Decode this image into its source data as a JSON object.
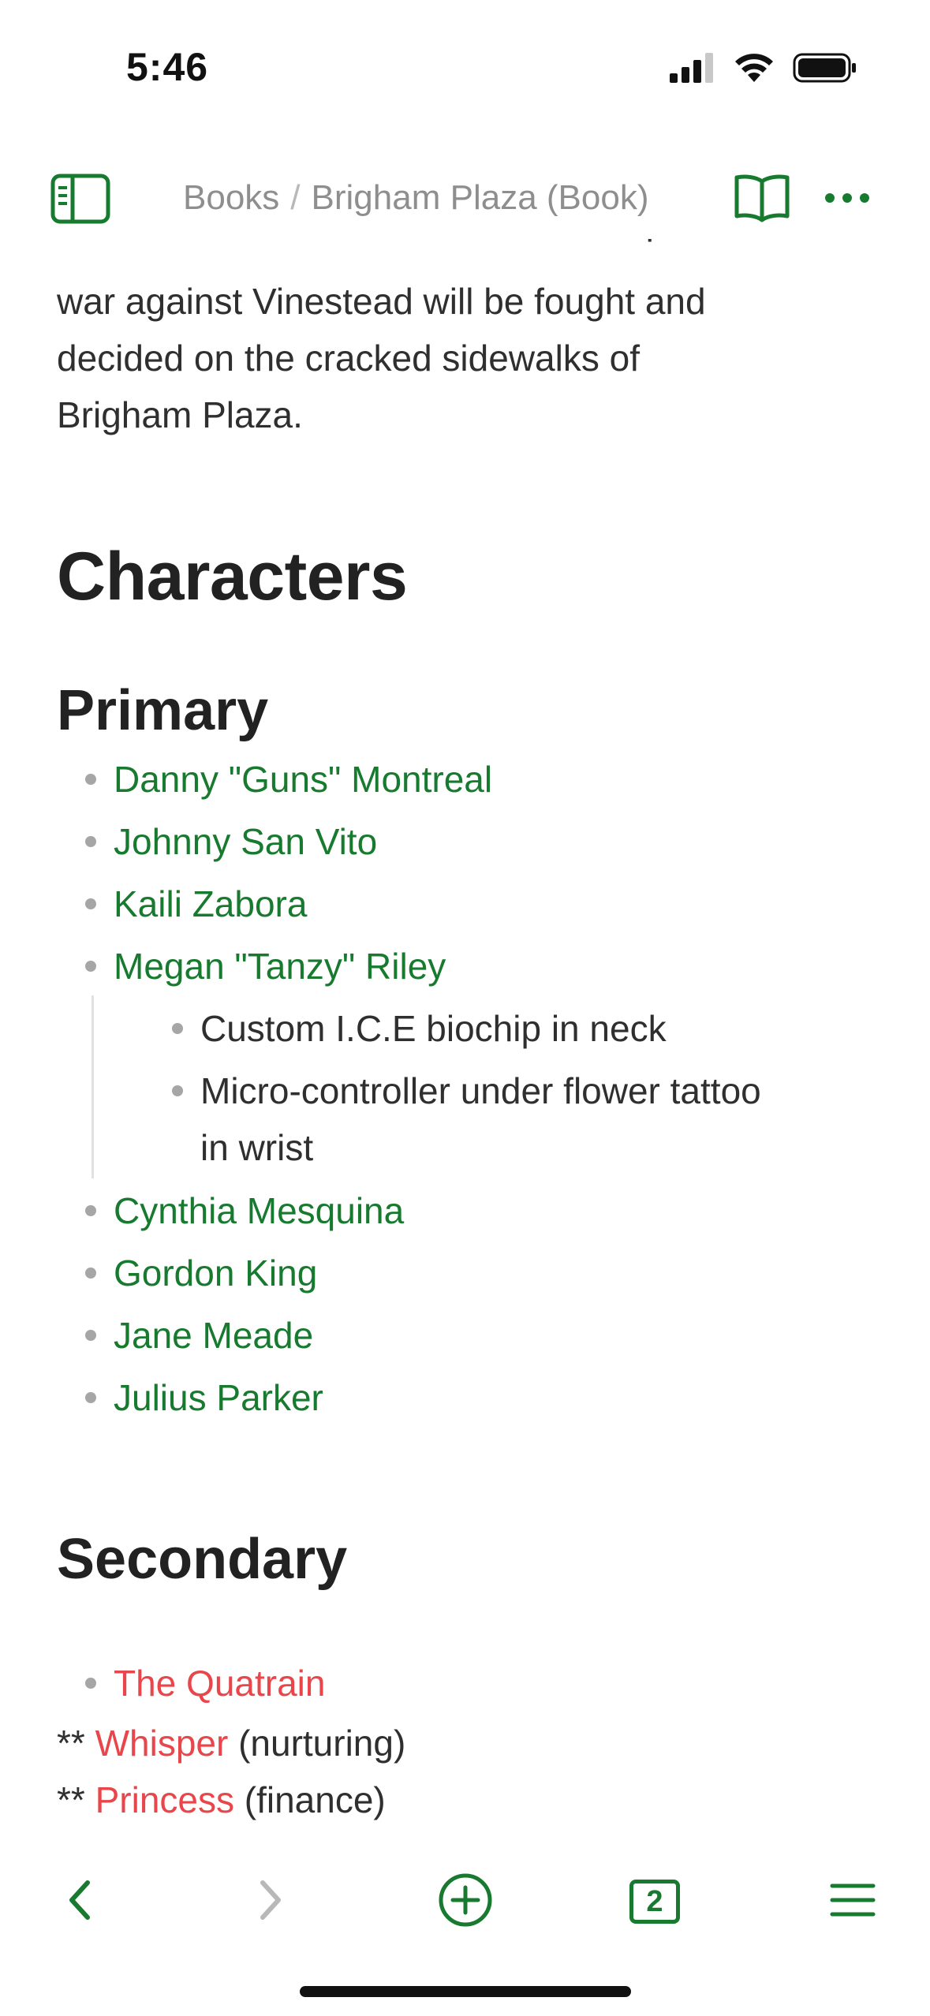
{
  "status_bar": {
    "time": "5:46"
  },
  "header": {
    "breadcrumb_parent": "Books",
    "breadcrumb_separator": "/",
    "breadcrumb_current": "Brigham Plaza (Book)"
  },
  "content": {
    "intro_lines": [
      "war against Vinestead will be fought and",
      "decided on the cracked sidewalks of",
      "Brigham Plaza."
    ],
    "heading_characters": "Characters",
    "heading_primary": "Primary",
    "primary": [
      "Danny \"Guns\" Montreal",
      "Johnny San Vito",
      "Kaili Zabora",
      "Megan \"Tanzy\" Riley"
    ],
    "megan_notes": [
      "Custom I.C.E biochip in neck",
      "Micro-controller under flower tattoo",
      "in wrist"
    ],
    "primary_more": [
      "Cynthia Mesquina",
      "Gordon King",
      "Jane Meade",
      "Julius Parker"
    ],
    "heading_secondary": "Secondary",
    "secondary_item": "The Quatrain",
    "secondary_lines": [
      {
        "prefix": "** ",
        "link": "Whisper",
        "suffix": " (nurturing)"
      },
      {
        "prefix": "** ",
        "link": "Princess",
        "suffix": " (finance)"
      }
    ]
  },
  "toolbar": {
    "tabs_count": "2"
  },
  "colors": {
    "accent": "#177a2f",
    "missing_link": "#e8464a",
    "bullet": "#a6a6a6"
  }
}
